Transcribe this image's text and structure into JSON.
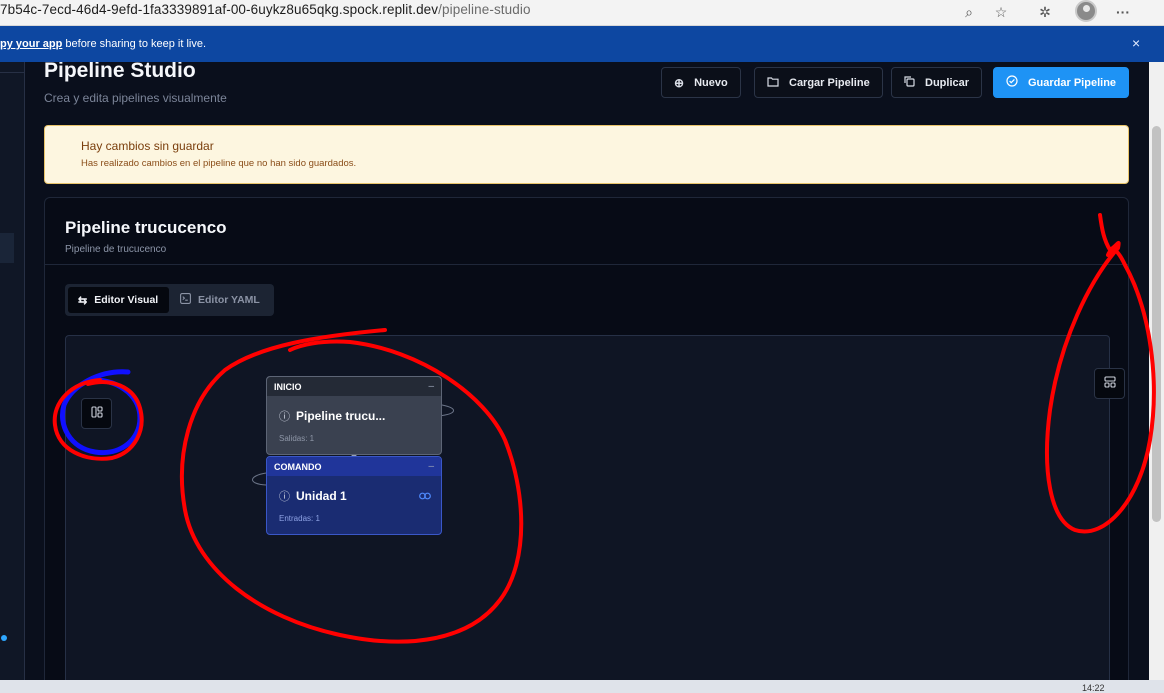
{
  "browser": {
    "url_host": "7b54c-7ecd-46d4-9efd-1fa3339891af-00-6uykz8u65qkg.spock.replit.dev",
    "url_path": "/pipeline-studio",
    "menu_glyph": "···"
  },
  "banner": {
    "link": "py your app",
    "text": " before sharing to keep it live.",
    "close": "×"
  },
  "page": {
    "title": "Pipeline Studio",
    "subtitle": "Crea y edita pipelines visualmente"
  },
  "toolbar": {
    "new_label": "Nuevo",
    "load_label": "Cargar Pipeline",
    "duplicate_label": "Duplicar",
    "save_label": "Guardar Pipeline"
  },
  "alert": {
    "title": "Hay cambios sin guardar",
    "description": "Has realizado cambios en el pipeline que no han sido guardados."
  },
  "pipeline": {
    "name": "Pipeline trucucenco",
    "description": "Pipeline de trucucenco"
  },
  "tabs": [
    {
      "label": "Editor Visual",
      "active": true
    },
    {
      "label": "Editor YAML",
      "active": false
    }
  ],
  "nodes": [
    {
      "type": "INICIO",
      "name": "Pipeline trucu...",
      "meta": "Salidas: 1"
    },
    {
      "type": "COMANDO",
      "name": "Unidad 1",
      "meta": "Entradas: 1"
    }
  ],
  "taskbar": {
    "time": "14:22"
  },
  "colors": {
    "primary": "#1e93f5",
    "banner": "#0d47a1",
    "warning_bg": "#fdf6e0",
    "annotation_red": "#ff0000",
    "annotation_blue": "#1010ff"
  }
}
